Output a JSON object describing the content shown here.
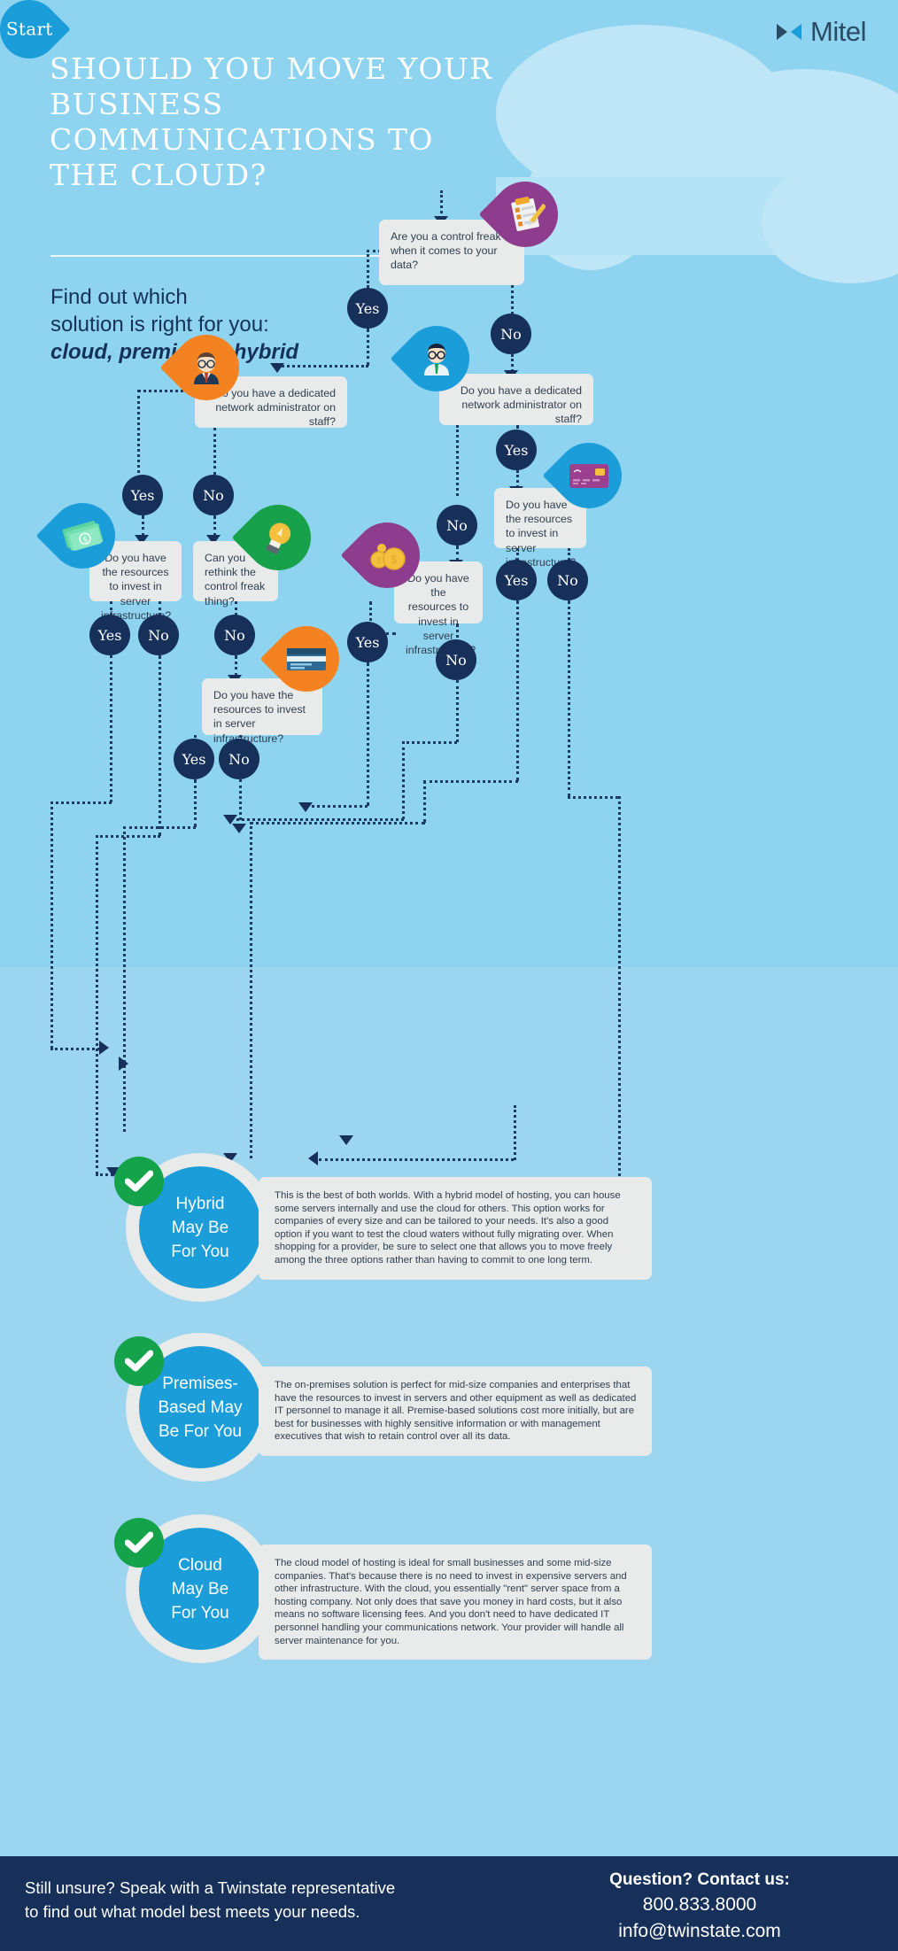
{
  "brand": {
    "name": "Mitel",
    "logo_icon": "mitel-bowtie-icon",
    "color": "#2b4a63"
  },
  "header": {
    "headline": "SHOULD YOU MOVE YOUR BUSINESS COMMUNICATIONS TO THE CLOUD?",
    "subhead_line1": "Find out which",
    "subhead_line2": "solution is right for you:",
    "subhead_emphasis": "cloud, premise or hybrid"
  },
  "flow": {
    "start_label": "Start",
    "nodes": [
      {
        "id": "q1",
        "text": "Are you a control freak when it comes to your data?",
        "icon": "clipboard-checklist-icon",
        "icon_color": "#8e3d8e"
      },
      {
        "id": "q2",
        "text": "Do you have a dedicated network administrator on staff?",
        "icon": "businessman-orange-icon",
        "icon_color": "#f58220"
      },
      {
        "id": "q3",
        "text": "Do you have a dedicated network administrator on staff?",
        "icon": "businessman-blue-icon",
        "icon_color": "#1b9dd9"
      },
      {
        "id": "q4",
        "text": "Do you have the resources to invest in server infrastructure?",
        "icon": "cash-banknotes-icon",
        "icon_color": "#1b9dd9"
      },
      {
        "id": "q5",
        "text": "Can you rethink the control freak thing?",
        "icon": "lightbulb-icon",
        "icon_color": "#17a14b"
      },
      {
        "id": "q6",
        "text": "Do you have the resources to invest in server infrastructure?",
        "icon": "coins-icon",
        "icon_color": "#8e3d8e"
      },
      {
        "id": "q7",
        "text": "Do you have the resources to invest in server infrastructure?",
        "icon": "credit-card-purple-icon",
        "icon_color": "#1b9dd9"
      },
      {
        "id": "q8",
        "text": "Do you have the resources to invest in server infrastructure?",
        "icon": "credit-card-blue-icon",
        "icon_color": "#f58220"
      }
    ],
    "answers": {
      "yes": "Yes",
      "no": "No",
      "sequence": [
        "Yes",
        "No",
        "Yes",
        "No",
        "No",
        "Yes",
        "Yes",
        "No",
        "No",
        "Yes",
        "Yes",
        "No",
        "Yes",
        "No",
        "Yes",
        "No"
      ]
    }
  },
  "results": [
    {
      "id": "hybrid",
      "title_lines": [
        "Hybrid",
        "May Be",
        "For You"
      ],
      "badge_icon": "check-circle-icon",
      "badge_color": "#14a24a",
      "orb_color": "#1b9dd9",
      "description": "This is the best of both worlds. With a hybrid model of hosting, you can house some servers internally and use the cloud for others. This option works for companies of every size and can be tailored to your needs. It's also a good option if you want to test the cloud waters without fully migrating over. When shopping for a provider, be sure to select one that allows you to move freely among the three options rather than having to commit to one long term."
    },
    {
      "id": "premises",
      "title_lines": [
        "Premises-",
        "Based May",
        "Be For You"
      ],
      "badge_icon": "check-circle-icon",
      "badge_color": "#14a24a",
      "orb_color": "#1b9dd9",
      "description": "The on-premises solution is perfect for mid-size companies and enterprises that have the resources to invest in servers and other equipment as well as dedicated IT personnel to manage it all. Premise-based solutions cost more initially, but are best for businesses with highly sensitive information or with management executives that wish to retain control over all its data."
    },
    {
      "id": "cloud",
      "title_lines": [
        "Cloud",
        "May Be",
        "For You"
      ],
      "badge_icon": "check-circle-icon",
      "badge_color": "#14a24a",
      "orb_color": "#1b9dd9",
      "description": "The cloud model of hosting is ideal for small businesses and some mid-size companies. That's because there is no need to invest in expensive servers and other infrastructure. With the cloud, you essentially \"rent\" server space from a hosting company. Not only does that save you money in hard costs, but it also means no software licensing fees. And you don't need to have dedicated IT personnel handling your communications network. Your provider will handle all server maintenance for you."
    }
  ],
  "footer": {
    "left_line1": "Still unsure? Speak with a Twinstate representative",
    "left_line2": "to find out what model best meets your needs.",
    "contact_title": "Question? Contact us:",
    "phone": "800.833.8000",
    "email": "info@twinstate.com"
  }
}
